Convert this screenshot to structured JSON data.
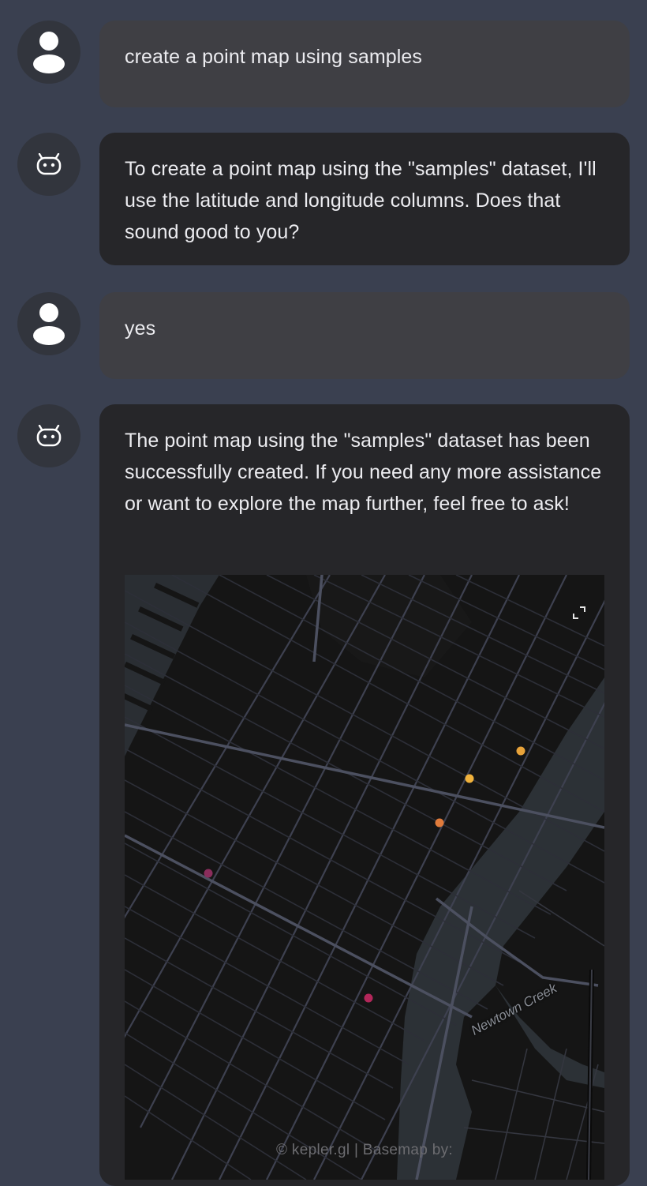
{
  "messages": [
    {
      "role": "user",
      "text": "create a point map using samples"
    },
    {
      "role": "assistant",
      "text": "To create a point map using the \"samples\" dataset, I'll use the latitude and longitude columns. Does that sound good to you?"
    },
    {
      "role": "user",
      "text": "yes"
    },
    {
      "role": "assistant",
      "text": "The point map using the \"samples\" dataset has been successfully created. If you need any more assistance or want to explore the map further, feel free to ask!"
    }
  ],
  "map": {
    "water_label": "Newtown Creek",
    "attribution": "© kepler.gl | Basemap by:",
    "points": [
      {
        "color": "#e8a33a"
      },
      {
        "color": "#f0b23c"
      },
      {
        "color": "#e07b3b"
      },
      {
        "color": "#8a2d5c"
      },
      {
        "color": "#b3275a"
      }
    ]
  },
  "icons": {
    "user_avatar": "user-icon",
    "assistant_avatar": "robot-icon",
    "map_expand": "expand-icon"
  }
}
